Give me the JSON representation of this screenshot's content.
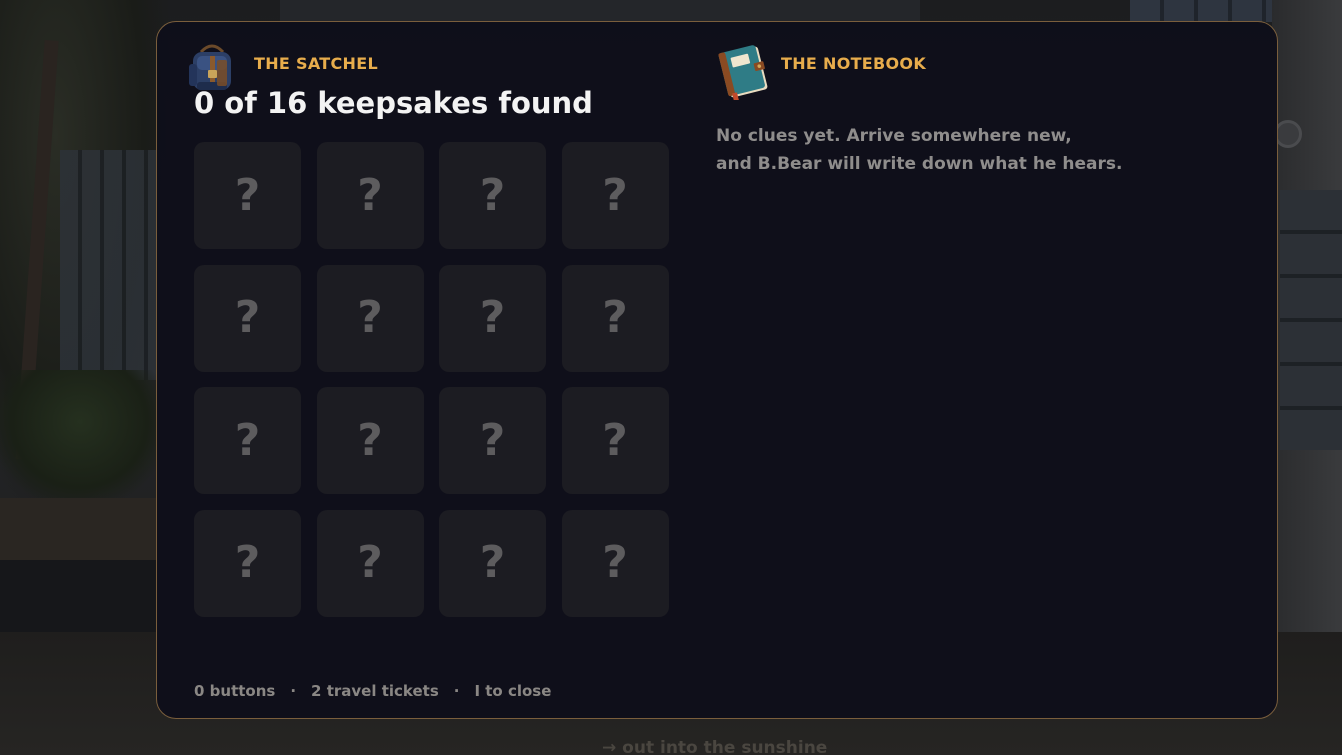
{
  "satchel": {
    "title": "THE SATCHEL",
    "found_text": "0 of 16 keepsakes found",
    "icon": "backpack-icon",
    "slots": [
      "?",
      "?",
      "?",
      "?",
      "?",
      "?",
      "?",
      "?",
      "?",
      "?",
      "?",
      "?",
      "?",
      "?",
      "?",
      "?"
    ]
  },
  "notebook": {
    "title": "THE NOTEBOOK",
    "icon": "notebook-icon",
    "lines": [
      "No clues yet. Arrive somewhere new,",
      "and B.Bear will write down what he hears."
    ]
  },
  "footer": {
    "buttons": "0 buttons",
    "tickets": "2 travel tickets",
    "close_hint": "I to close",
    "separator": "·"
  },
  "background": {
    "hint": "→ out into the sunshine"
  },
  "colors": {
    "panel_bg": "#0e0e1a",
    "panel_border": "#7a5e3c",
    "accent": "#e8ad4c",
    "slot_bg": "#1c1c22",
    "muted_text": "#8f8d8c"
  }
}
